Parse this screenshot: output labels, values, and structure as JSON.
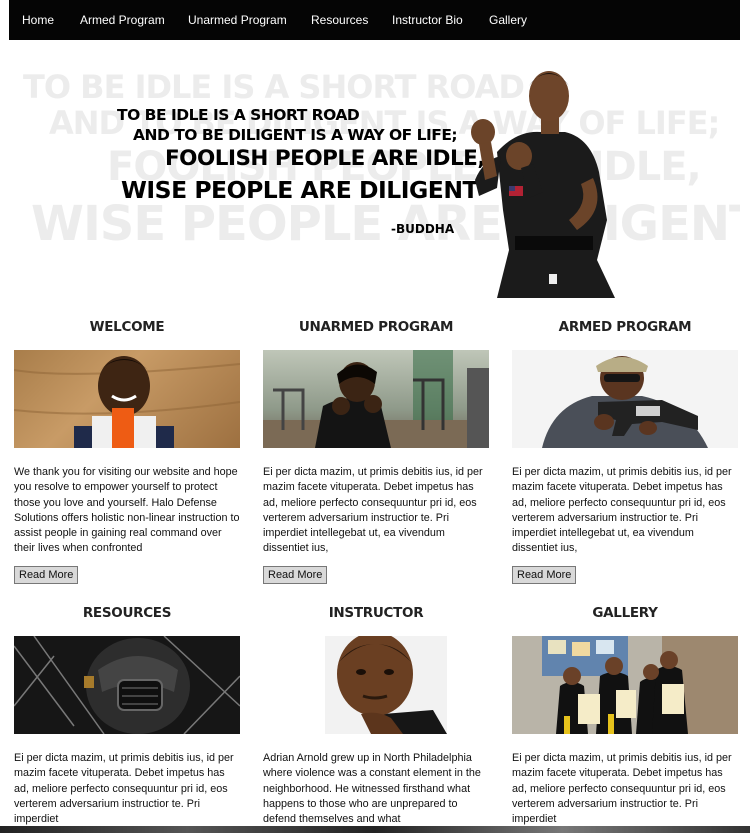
{
  "nav": {
    "items": [
      "Home",
      "Armed Program",
      "Unarmed Program",
      "Resources",
      "Instructor Bio",
      "Gallery"
    ]
  },
  "hero": {
    "quote_lines": [
      "TO BE IDLE IS A SHORT ROAD",
      "AND TO BE DILIGENT IS A WAY OF LIFE;",
      "FOOLISH PEOPLE ARE IDLE,",
      "WISE PEOPLE ARE DILIGENT"
    ],
    "author": "-BUDDHA"
  },
  "cards": [
    {
      "title": "WELCOME",
      "text": "We thank you for visiting our website and hope you resolve to empower yourself to protect those you love and yourself. Halo Defense Solutions offers holistic non-linear instruction to assist people in gaining real command over their lives when confronted",
      "button": "Read More"
    },
    {
      "title": "UNARMED PROGRAM",
      "text": "Ei per dicta mazim, ut primis debitis ius, id per mazim facete vituperata. Debet impetus has ad, meliore perfecto consequuntur pri id, eos verterem adversarium instructior te. Pri imperdiet intellegebat ut, ea vivendum dissentiet ius,",
      "button": "Read More"
    },
    {
      "title": "ARMED PROGRAM",
      "text": "Ei per dicta mazim, ut primis debitis ius, id per mazim facete vituperata. Debet impetus has ad, meliore perfecto consequuntur pri id, eos verterem adversarium instructior te. Pri imperdiet intellegebat ut, ea vivendum dissentiet ius,",
      "button": "Read More"
    },
    {
      "title": "RESOURCES",
      "text": "Ei per dicta mazim, ut primis debitis ius, id per mazim facete vituperata. Debet impetus has ad, meliore perfecto consequuntur pri id, eos verterem adversarium instructior te. Pri imperdiet"
    },
    {
      "title": "INSTRUCTOR",
      "text": "Adrian Arnold grew up in North Philadelphia where violence was a constant element in the neighborhood. He witnessed firsthand what happens to those who are unprepared to defend themselves and what"
    },
    {
      "title": "GALLERY",
      "text": "Ei per dicta mazim, ut primis debitis ius, id per mazim facete vituperata. Debet impetus has ad, meliore perfecto consequuntur pri id, eos verterem adversarium instructior te. Pri imperdiet"
    }
  ],
  "colors": {
    "nav_bg": "#050505",
    "button_bg": "#d9d9d9",
    "ghost_text": "#ececec"
  }
}
